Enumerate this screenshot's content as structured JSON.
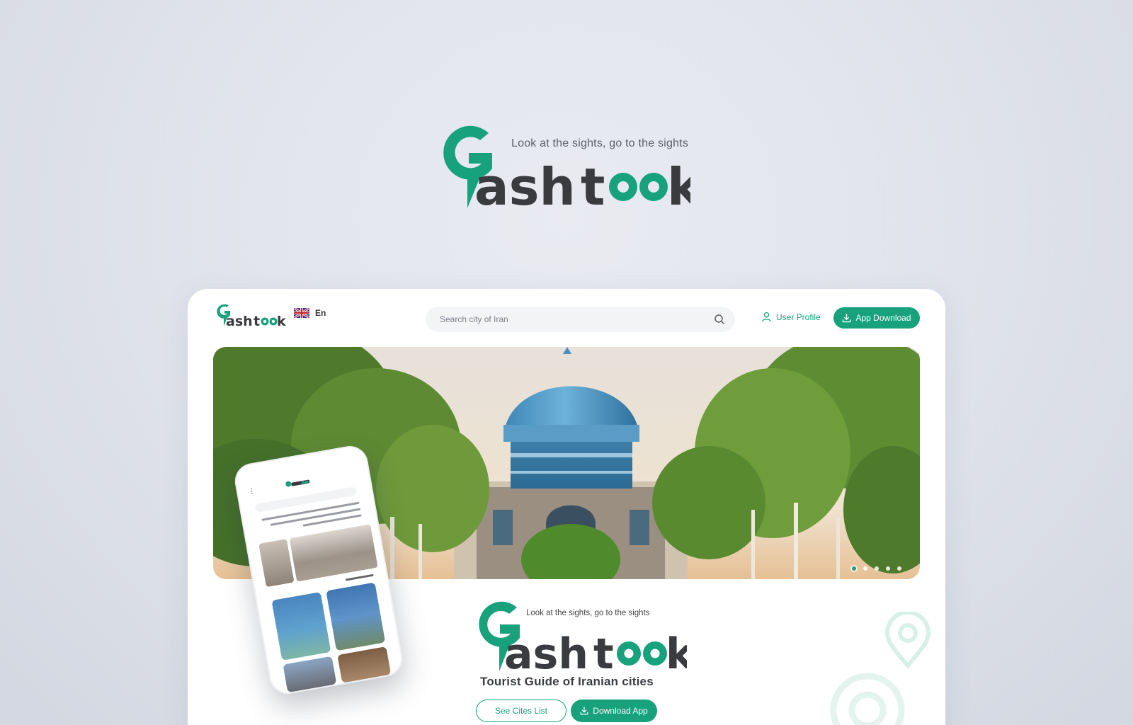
{
  "hero": {
    "tagline": "Look at the sights, go to the sights",
    "brand": "Gashtook"
  },
  "colors": {
    "brand_green": "#17a27c",
    "dark_text": "#3b3d42"
  },
  "nav": {
    "language_label": "En",
    "language_flag_icon": "uk-flag-icon",
    "search_placeholder": "Search city of Iran",
    "user_profile_label": "User Profile",
    "app_download_label": "App Download"
  },
  "banner": {
    "slide_count": 5,
    "active_slide": 1
  },
  "content": {
    "tagline": "Look at the sights, go to the sights",
    "title": "Tourist Guide of Iranian cities",
    "see_cities_label": "See Cites List",
    "download_app_label": "Download App"
  }
}
